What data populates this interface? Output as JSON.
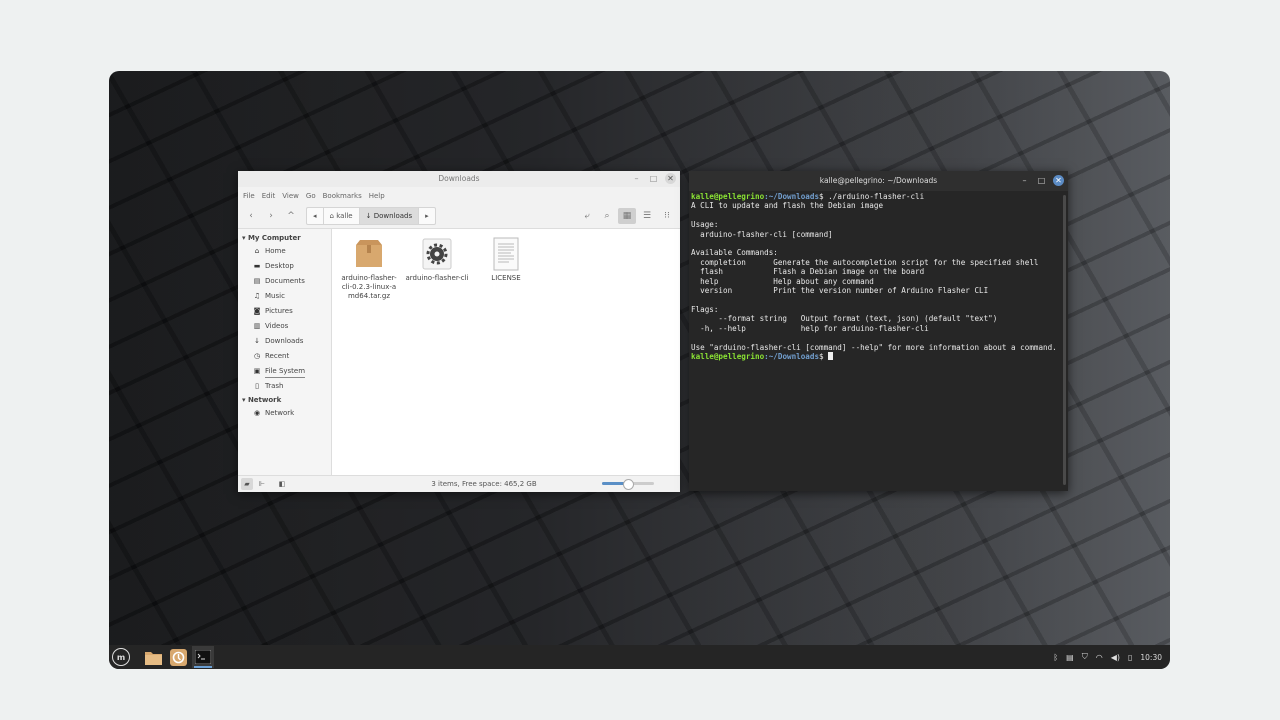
{
  "file_manager": {
    "title": "Downloads",
    "menu": [
      "File",
      "Edit",
      "View",
      "Go",
      "Bookmarks",
      "Help"
    ],
    "breadcrumb": [
      "kalle",
      "Downloads"
    ],
    "sidebar": {
      "computer_heading": "My Computer",
      "computer_items": [
        {
          "label": "Home",
          "icon": "home-icon"
        },
        {
          "label": "Desktop",
          "icon": "desktop-icon"
        },
        {
          "label": "Documents",
          "icon": "documents-icon"
        },
        {
          "label": "Music",
          "icon": "music-icon"
        },
        {
          "label": "Pictures",
          "icon": "pictures-icon"
        },
        {
          "label": "Videos",
          "icon": "videos-icon"
        },
        {
          "label": "Downloads",
          "icon": "download-icon"
        },
        {
          "label": "Recent",
          "icon": "recent-icon"
        },
        {
          "label": "File System",
          "icon": "drive-icon"
        },
        {
          "label": "Trash",
          "icon": "trash-icon"
        }
      ],
      "network_heading": "Network",
      "network_items": [
        {
          "label": "Network",
          "icon": "network-icon"
        }
      ]
    },
    "files": [
      {
        "name": "arduino-flasher-cli-0.2.3-linux-amd64.tar.gz",
        "icon": "archive-icon"
      },
      {
        "name": "arduino-flasher-cli",
        "icon": "executable-gear-icon"
      },
      {
        "name": "LICENSE",
        "icon": "text-file-icon"
      }
    ],
    "status": "3 items, Free space: 465,2 GB",
    "zoom_level": 0.5
  },
  "terminal": {
    "title": "kalle@pellegrino: ~/Downloads",
    "prompt_user": "kalle@pellegrino",
    "prompt_path": ":~/Downloads",
    "prompt_symbol": "$",
    "command": " ./arduino-flasher-cli",
    "output": "A CLI to update and flash the Debian image\n\nUsage:\n  arduino-flasher-cli [command]\n\nAvailable Commands:\n  completion      Generate the autocompletion script for the specified shell\n  flash           Flash a Debian image on the board\n  help            Help about any command\n  version         Print the version number of Arduino Flasher CLI\n\nFlags:\n      --format string   Output format (text, json) (default \"text\")\n  -h, --help            help for arduino-flasher-cli\n\nUse \"arduino-flasher-cli [command] --help\" for more information about a command."
  },
  "panel": {
    "clock": "10:30",
    "launchers": [
      "files-folder-icon",
      "update-manager-icon",
      "terminal-icon"
    ],
    "tray_icons": [
      "bluetooth-icon",
      "clipboard-icon",
      "shield-icon",
      "wifi-icon",
      "volume-icon",
      "battery-icon"
    ]
  },
  "colors": {
    "accent": "#5b8bc4",
    "prompt_user": "#8ae234",
    "prompt_path": "#729fcf"
  }
}
